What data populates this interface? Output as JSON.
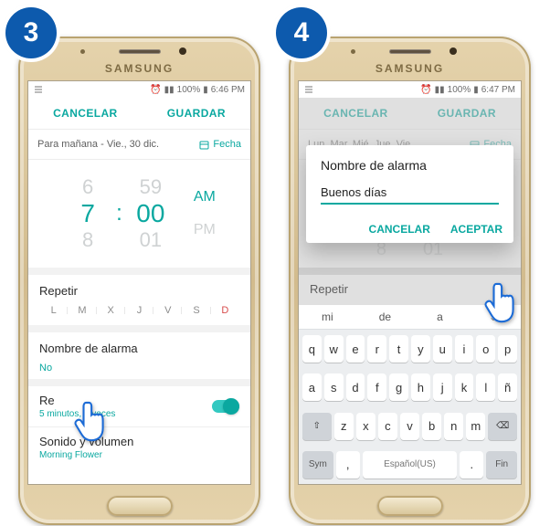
{
  "steps": {
    "left": "3",
    "right": "4"
  },
  "brand": "SAMSUNG",
  "status": {
    "battery": "100%",
    "time_left": "6:46 PM",
    "time_right": "6:47 PM"
  },
  "topbar": {
    "cancel": "CANCELAR",
    "save": "GUARDAR"
  },
  "date": {
    "label": "Para mañana - Vie., 30 dic.",
    "button": "Fecha"
  },
  "time": {
    "hour_prev": "6",
    "hour": "7",
    "hour_next": "8",
    "min_prev": "59",
    "min": "00",
    "min_next": "01",
    "am": "AM",
    "pm": "PM"
  },
  "repeat": {
    "title": "Repetir",
    "days": [
      "L",
      "M",
      "X",
      "J",
      "V",
      "S",
      "D"
    ]
  },
  "alarmname": {
    "title": "Nombre de alarma",
    "placeholder": "No"
  },
  "redial": {
    "title": "Re",
    "sub": "5 minutos, 3 veces"
  },
  "sound": {
    "title": "Sonido y volumen",
    "sub": "Morning Flower"
  },
  "rightDate": {
    "label": "Lun, Mar, Mié, Jue, Vie",
    "button": "Fecha"
  },
  "dialog": {
    "title": "Nombre de alarma",
    "value": "Buenos días",
    "cancel": "CANCELAR",
    "ok": "ACEPTAR"
  },
  "rightRepeat": "Repetir",
  "kb": {
    "sugg": [
      "mi",
      "de",
      "a"
    ],
    "r1": [
      "q",
      "w",
      "e",
      "r",
      "t",
      "y",
      "u",
      "i",
      "o",
      "p"
    ],
    "r2": [
      "a",
      "s",
      "d",
      "f",
      "g",
      "h",
      "j",
      "k",
      "l",
      "ñ"
    ],
    "shift": "⇧",
    "r3": [
      "z",
      "x",
      "c",
      "v",
      "b",
      "n",
      "m"
    ],
    "del": "⌫",
    "sym": "Sym",
    "comma": ",",
    "space": "Español(US)",
    "period": ".",
    "fin": "Fin"
  }
}
